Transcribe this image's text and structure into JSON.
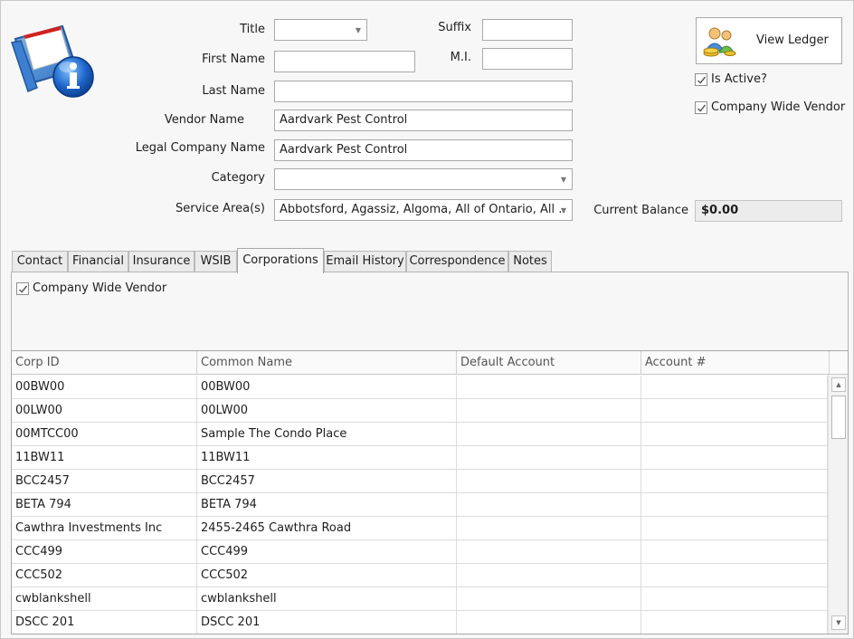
{
  "form": {
    "title_label": "Title",
    "title_value": "",
    "suffix_label": "Suffix",
    "suffix_value": "",
    "first_name_label": "First Name",
    "first_name_value": "",
    "mi_label": "M.I.",
    "mi_value": "",
    "last_name_label": "Last Name",
    "last_name_value": "",
    "vendor_name_label": "Vendor Name",
    "vendor_name_value": "Aardvark Pest Control",
    "legal_name_label": "Legal Company Name",
    "legal_name_value": "Aardvark Pest Control",
    "category_label": "Category",
    "category_value": "",
    "service_area_label": "Service Area(s)",
    "service_area_value": "Abbotsford, Agassiz, Algoma, All of Ontario, All ...",
    "current_balance_label": "Current Balance",
    "current_balance_value": "$0.00"
  },
  "right": {
    "view_ledger_label": "View Ledger",
    "is_active_label": "Is Active?",
    "is_active_checked": true,
    "company_wide_label": "Company Wide Vendor",
    "company_wide_checked": true
  },
  "tabs": [
    {
      "label": "Contact"
    },
    {
      "label": "Financial"
    },
    {
      "label": "Insurance"
    },
    {
      "label": "WSIB"
    },
    {
      "label": "Corporations",
      "active": true
    },
    {
      "label": "Email History"
    },
    {
      "label": "Correspondence"
    },
    {
      "label": "Notes"
    }
  ],
  "corporations": {
    "company_wide_label": "Company Wide Vendor",
    "company_wide_checked": true,
    "columns": [
      "Corp ID",
      "Common Name",
      "Default Account",
      "Account #"
    ],
    "rows": [
      [
        "00BW00",
        "00BW00",
        "",
        ""
      ],
      [
        "00LW00",
        "00LW00",
        "",
        ""
      ],
      [
        "00MTCC00",
        "Sample The Condo Place",
        "",
        ""
      ],
      [
        "11BW11",
        "11BW11",
        "",
        ""
      ],
      [
        "BCC2457",
        "BCC2457",
        "",
        ""
      ],
      [
        "BETA 794",
        "BETA 794",
        "",
        ""
      ],
      [
        "Cawthra Investments Inc",
        "2455-2465 Cawthra Road",
        "",
        ""
      ],
      [
        "CCC499",
        "CCC499",
        "",
        ""
      ],
      [
        "CCC502",
        "CCC502",
        "",
        ""
      ],
      [
        "cwblankshell",
        "cwblankshell",
        "",
        ""
      ],
      [
        "DSCC 201",
        "DSCC 201",
        "",
        ""
      ]
    ]
  },
  "icons": {
    "vendor_info": "info-folder-icon",
    "ledger": "people-coins-icon",
    "dropdown": "chevron-down-icon",
    "scroll_up": "scroll-up-icon",
    "scroll_down": "scroll-down-icon"
  }
}
